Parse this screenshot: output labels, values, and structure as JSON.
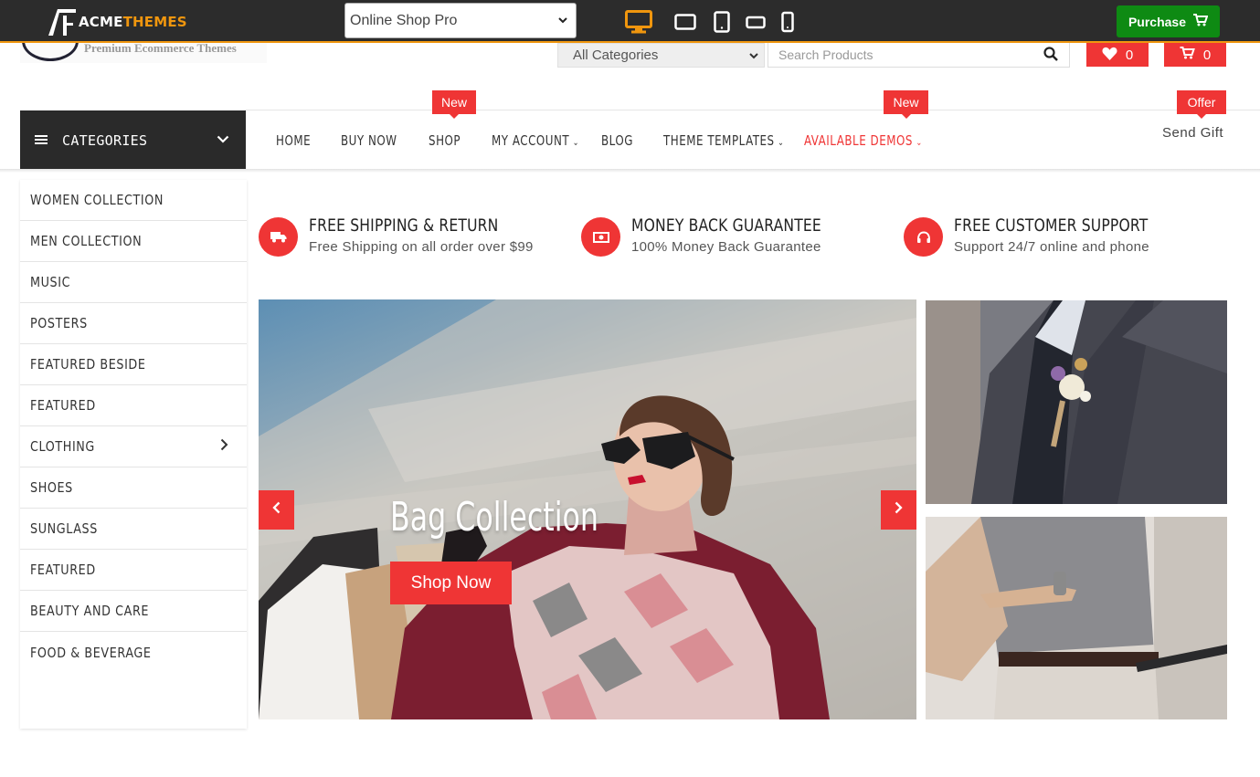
{
  "demo_bar": {
    "brand_acme": "ACME",
    "brand_themes": "THEMES",
    "theme_select": "Online Shop Pro",
    "purchase_label": "Purchase",
    "colors": {
      "bar": "#2c2c2c",
      "accent": "#f0960e",
      "purchase": "#0e8a13"
    },
    "devices": [
      "desktop-icon",
      "tablet-landscape-icon",
      "tablet-portrait-icon",
      "mobile-landscape-icon",
      "mobile-portrait-icon"
    ]
  },
  "header": {
    "tagline": "Premium Ecommerce Themes",
    "category_select": "All Categories",
    "search_placeholder": "Search Products",
    "wishlist_count": "0",
    "cart_count": "0"
  },
  "nav": {
    "categories_label": "CATEGORIES",
    "items": [
      {
        "label": "HOME"
      },
      {
        "label": "BUY NOW"
      },
      {
        "label": "SHOP",
        "badge": "New"
      },
      {
        "label": "MY ACCOUNT"
      },
      {
        "label": "BLOG"
      },
      {
        "label": "THEME TEMPLATES"
      },
      {
        "label": "AVAILABLE DEMOS",
        "badge": "New"
      }
    ],
    "gift_badge": "Offer",
    "gift_label": "Send Gift",
    "accent_color": "#ef3535"
  },
  "sidebar": {
    "items": [
      {
        "label": "WOMEN COLLECTION"
      },
      {
        "label": "MEN COLLECTION"
      },
      {
        "label": "MUSIC"
      },
      {
        "label": "POSTERS"
      },
      {
        "label": "FEATURED BESIDE"
      },
      {
        "label": "FEATURED"
      },
      {
        "label": "CLOTHING"
      },
      {
        "label": "SHOES"
      },
      {
        "label": "SUNGLASS"
      },
      {
        "label": "FEATURED"
      },
      {
        "label": "BEAUTY AND CARE"
      },
      {
        "label": "FOOD & BEVERAGE"
      }
    ]
  },
  "features": [
    {
      "title": "FREE SHIPPING & RETURN",
      "subtitle": "Free Shipping on all order over $99",
      "icon": "truck-icon"
    },
    {
      "title": "MONEY BACK GUARANTEE",
      "subtitle": "100% Money Back Guarantee",
      "icon": "money-icon"
    },
    {
      "title": "FREE CUSTOMER SUPPORT",
      "subtitle": "Support 24/7 online and phone",
      "icon": "headset-icon"
    }
  ],
  "slider": {
    "title": "Bag Collection",
    "button": "Shop Now"
  }
}
